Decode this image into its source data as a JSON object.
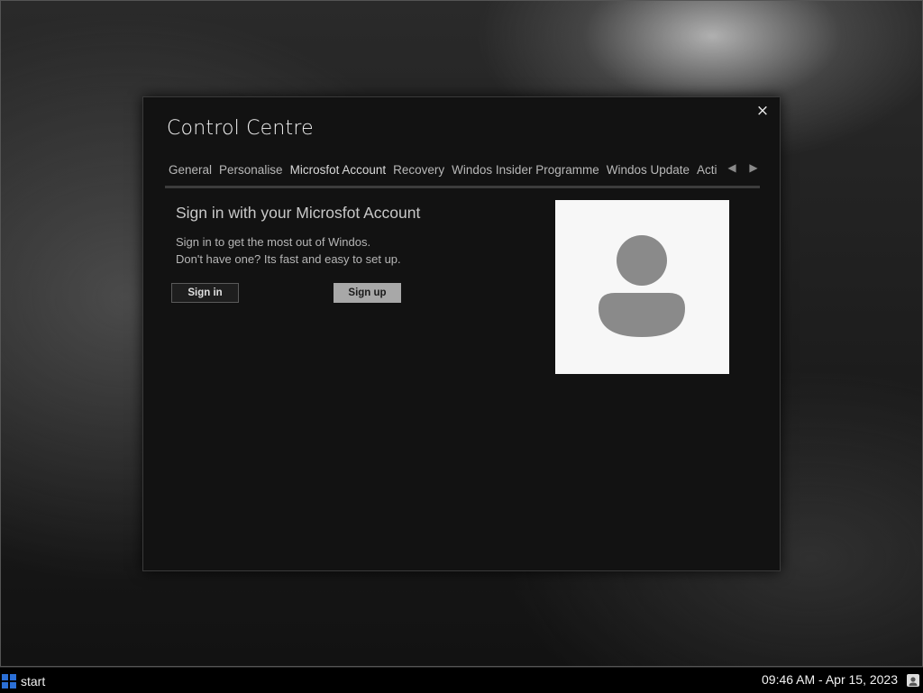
{
  "window": {
    "title": "Control Centre",
    "close_symbol": "×",
    "tabs": [
      {
        "label": "General"
      },
      {
        "label": "Personalise"
      },
      {
        "label": "Microsfot Account"
      },
      {
        "label": "Recovery"
      },
      {
        "label": "Windos Insider Programme"
      },
      {
        "label": "Windos Update"
      },
      {
        "label": "Acti"
      }
    ],
    "active_tab": "Microsfot Account",
    "tab_prev_arrow": "◀",
    "tab_next_arrow": "▶",
    "icons": {
      "close": "close-icon",
      "prev": "chevron-left-icon",
      "next": "chevron-right-icon",
      "avatar": "user-icon"
    }
  },
  "account": {
    "heading": "Sign in with your Microsfot Account",
    "line1": "Sign in to get the most out of Windos.",
    "line2": "Don't have one? Its fast and easy to set up.",
    "signin_label": "Sign in",
    "signup_label": "Sign up"
  },
  "taskbar": {
    "start_label": "start",
    "clock": "09:46 AM - Apr 15, 2023",
    "icons": {
      "start": "windows-logo-icon",
      "tray": "user-tray-icon"
    }
  },
  "colors": {
    "accent": "#2aa0d8",
    "start_logo": "#2b6fd6",
    "signup_button": "#a8a8a8",
    "window_bg": "#121212"
  }
}
